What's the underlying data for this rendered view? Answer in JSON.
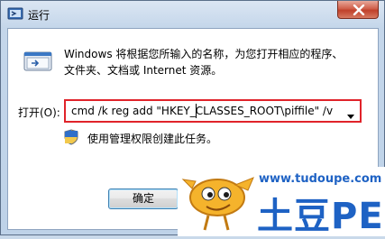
{
  "window": {
    "title": "运行",
    "close_icon": "close-icon"
  },
  "dialog": {
    "description_line1": "Windows 将根据您所输入的名称，为您打开相应的程序、",
    "description_line2": "文件夹、文档或 Internet 资源。",
    "open_label": "打开(O):",
    "command_value": "cmd /k reg add \"HKEY_CLASSES_ROOT\\piffile\" /v Is",
    "admin_note": "使用管理权限创建此任务。",
    "ok_label": "确定"
  },
  "watermark": {
    "url": "www.tudoupe.com",
    "text": "土豆PE"
  },
  "colors": {
    "highlight_border": "#e0232a",
    "watermark_blue": "#1e62c4"
  }
}
